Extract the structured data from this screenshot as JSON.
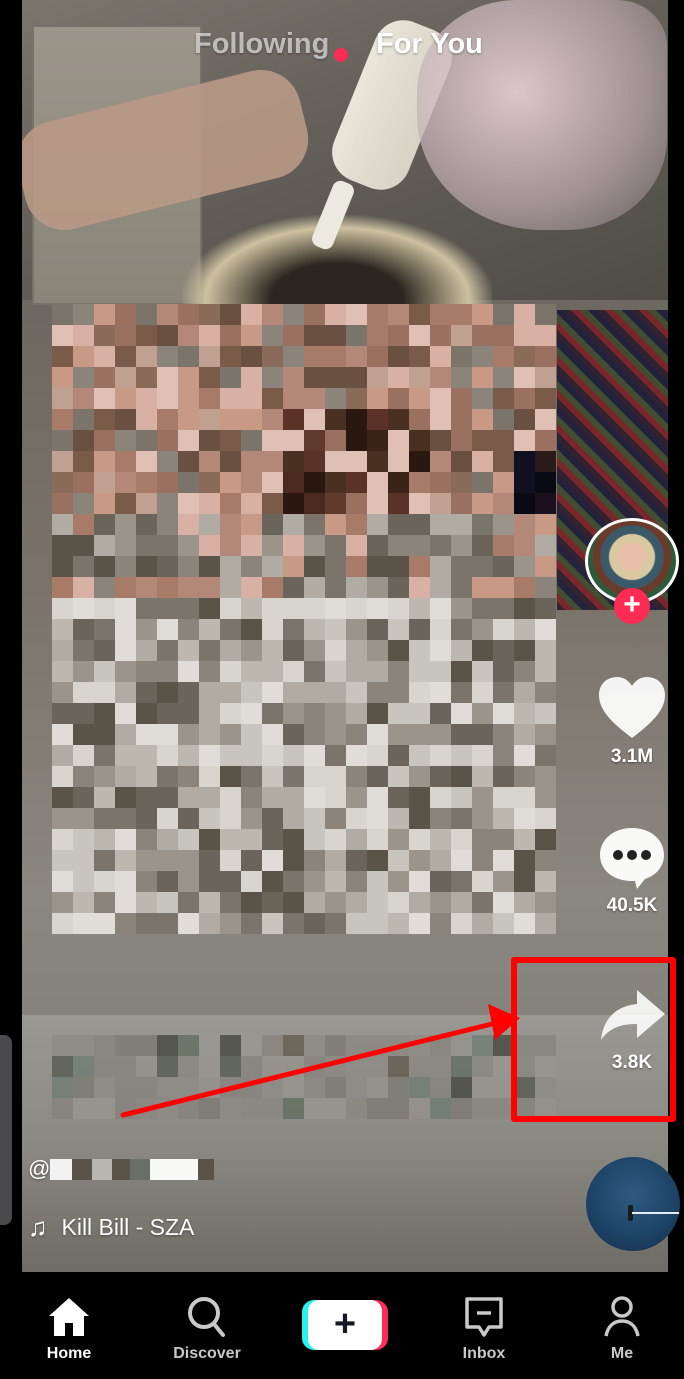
{
  "top_tabs": {
    "following_label": "Following",
    "for_you_label": "For You",
    "active": "For You",
    "live_dot_color": "#fe2c55"
  },
  "right_rail": {
    "avatar": {
      "follow_icon": "plus-icon",
      "follow_symbol": "+"
    },
    "like": {
      "icon": "heart-icon",
      "count": "3.1M"
    },
    "comment": {
      "icon": "comment-bubble-icon",
      "count": "40.5K"
    },
    "share": {
      "icon": "share-arrow-icon",
      "count": "3.8K"
    },
    "sound_disc": {
      "icon": "music-disc"
    }
  },
  "caption": {
    "at_symbol": "@",
    "username_redacted": true,
    "music_icon": "music-note-icon",
    "music_note_glyph": "♫",
    "sound_title": "Kill Bill - SZA"
  },
  "annotation": {
    "type": "red-box-with-arrow",
    "target": "share",
    "color": "#ff0000"
  },
  "bottom_nav": {
    "items": [
      {
        "label": "Home",
        "icon": "home-icon",
        "active": true
      },
      {
        "label": "Discover",
        "icon": "search-icon",
        "active": false
      },
      {
        "label": "",
        "icon": "create-plus-icon",
        "symbol": "+",
        "active": false
      },
      {
        "label": "Inbox",
        "icon": "inbox-icon",
        "active": false
      },
      {
        "label": "Me",
        "icon": "profile-icon",
        "active": false
      }
    ]
  },
  "colors": {
    "brand_pink": "#fe2c55",
    "brand_cyan": "#25f4ee",
    "nav_background": "#000000"
  }
}
